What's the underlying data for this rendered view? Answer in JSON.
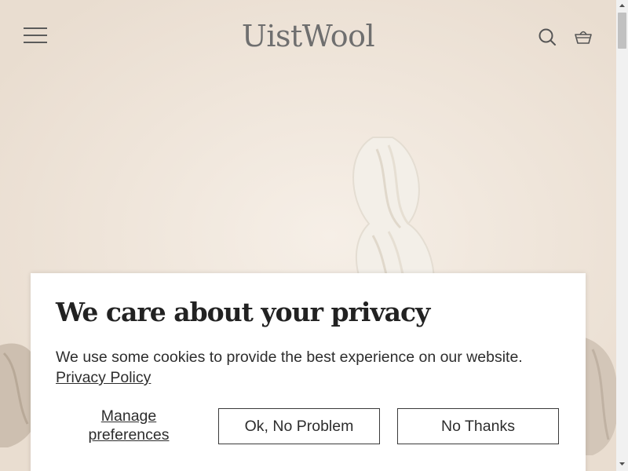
{
  "header": {
    "logo_text": "UistWool",
    "menu_icon": "hamburger-menu-icon",
    "search_icon": "search-icon",
    "cart_icon": "basket-icon"
  },
  "privacy_modal": {
    "title": "We care about your privacy",
    "body": "We use some cookies to provide the best experience on our website.",
    "policy_link": "Privacy Policy",
    "manage_label": "Manage preferences",
    "accept_label": "Ok, No Problem",
    "decline_label": "No Thanks"
  },
  "colors": {
    "background": "#efe6dc",
    "logo": "#6f6f6f",
    "modal_bg": "#ffffff",
    "button_border": "#3a3a3a"
  }
}
